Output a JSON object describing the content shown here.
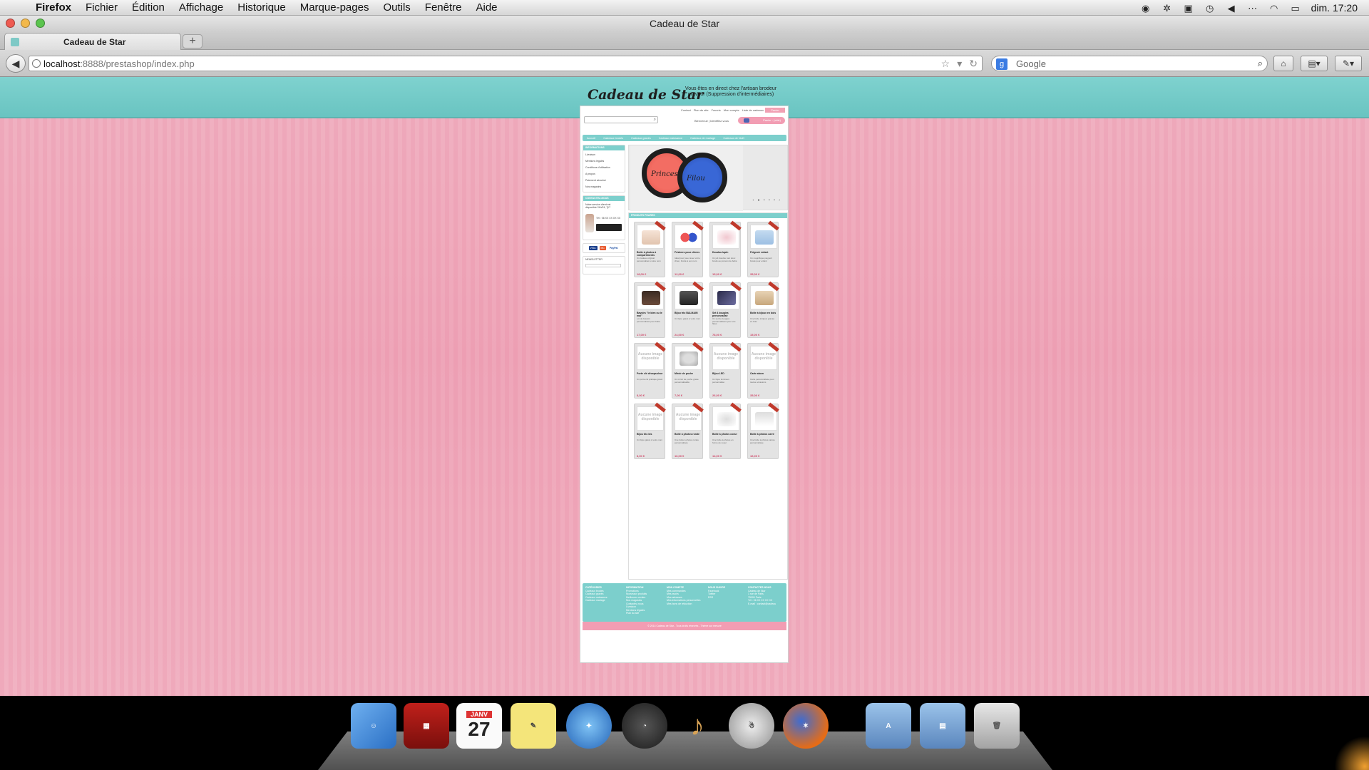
{
  "os_menubar": {
    "app_name": "Firefox",
    "menus": [
      "Fichier",
      "Édition",
      "Affichage",
      "Historique",
      "Marque-pages",
      "Outils",
      "Fenêtre",
      "Aide"
    ],
    "clock": "dim. 17:20"
  },
  "window": {
    "title": "Cadeau de Star"
  },
  "tabs": [
    {
      "label": "Cadeau de Star"
    }
  ],
  "navbar": {
    "url_host": "localhost",
    "url_rest": ":8888/prestashop/index.php",
    "search_placeholder": "Google"
  },
  "shop": {
    "logo": "Cadeau de Star",
    "tagline": "Vous êtes en direct chez l'artisan brodeur graveur (Suppression d'intermédiaires)",
    "top_links": [
      "Contact",
      "Plan du site",
      "Favoris",
      "Mon compte",
      "Liste de cadeaux"
    ],
    "panier_label": "Panier",
    "user_info": "Bienvenue | Identifiez-vous",
    "cart_label": "Panier : (vide)",
    "categories": [
      "Accueil",
      "Cadeaux brodés",
      "Cadeaux gravés",
      "Cadeaux naissance",
      "Cadeaux de mariage",
      "Cadeaux de Noël"
    ],
    "sidebar": {
      "info_title": "INFORMATIONS",
      "info_links": [
        "Livraison",
        "Mentions légales",
        "Conditions d'utilisation",
        "A propos",
        "Paiement sécurisé",
        "Nos magasins"
      ],
      "contact_title": "CONTACTEZ-NOUS",
      "contact_text": "Notre service client est disponible 24h/24, 7j/7",
      "contact_tel": "Tél : 06 XX XX XX XX",
      "payment": [
        "VISA",
        "MC",
        "PayPal"
      ],
      "newsletter_title": "NEWSLETTER"
    },
    "slider": {
      "text_left": "Princesse",
      "text_right": "Filou"
    },
    "featured_title": "PRODUITS PHARES",
    "products": [
      {
        "name": "Boîte à photos à compartiments",
        "desc": "Un cadeau original personnalisé à votre nom",
        "price": "18,00 €",
        "img": "box"
      },
      {
        "name": "Frisbees pour chiens",
        "desc": "Idéal pour jouer avec votre chien, brodé à son nom",
        "price": "12,00 €",
        "img": "frisbee"
      },
      {
        "name": "Doudou lapin",
        "desc": "Un joli doudou tout doux brodé au prénom de bébé",
        "price": "15,00 €",
        "img": "lapin"
      },
      {
        "name": "Peignoir enfant",
        "desc": "Un magnifique peignoir brodé pour enfant",
        "price": "35,00 €",
        "img": "peignoir"
      },
      {
        "name": "Bavoirs \"le bien ou le mal\"",
        "desc": "Lot de bavoirs personnalisés pour bébé",
        "price": "17,00 €",
        "img": "bavoir"
      },
      {
        "name": "Bijou trio BALMAIN",
        "desc": "Un bijou gravé à votre nom",
        "price": "24,00 €",
        "img": "trio"
      },
      {
        "name": "Set 4 bougies personnalisé",
        "desc": "Un set de bougies personnalisées pour vos fêtes",
        "price": "78,00 €",
        "img": "bougies"
      },
      {
        "name": "Boîte à bijoux en bois",
        "desc": "Une boîte à bijoux gravée en bois",
        "price": "15,00 €",
        "img": "boite"
      },
      {
        "name": "Porte clé décapsuleur",
        "desc": "Un porte clé pratique gravé",
        "price": "8,00 €",
        "img": "none"
      },
      {
        "name": "Miroir de poche",
        "desc": "Un miroir de poche gravé personnalisable",
        "price": "7,00 €",
        "img": "miroir"
      },
      {
        "name": "Bijou LED",
        "desc": "Un bijou lumineux personnalisé",
        "price": "26,00 €",
        "img": "none"
      },
      {
        "name": "Carte abcm",
        "desc": "Carte personnalisée pour toutes occasions",
        "price": "35,00 €",
        "img": "none"
      },
      {
        "name": "Bijou trio bis",
        "desc": "Un bijou gravé à votre nom",
        "price": "8,00 €",
        "img": "none"
      },
      {
        "name": "Boîte à photos ronde",
        "desc": "Une boîte à photos ronde personnalisée",
        "price": "16,00 €",
        "img": "none"
      },
      {
        "name": "Boîte à photos coeur",
        "desc": "Une boîte à photos en forme de coeur",
        "price": "14,00 €",
        "img": "coeur"
      },
      {
        "name": "Boîte à photos carré",
        "desc": "Une boîte à photos carrée personnalisée",
        "price": "16,00 €",
        "img": "carre"
      }
    ],
    "no_image_text": "Aucune image disponible",
    "footer": {
      "cols": [
        {
          "title": "CATÉGORIES",
          "lines": [
            "Cadeaux brodés",
            "Cadeaux gravés",
            "Cadeaux naissance",
            "Cadeaux mariage"
          ]
        },
        {
          "title": "INFORMATION",
          "lines": [
            "Promotions",
            "Nouveaux produits",
            "Meilleures ventes",
            "Nos magasins",
            "Contactez-nous",
            "Livraison",
            "Mentions légales",
            "Plan du site"
          ]
        },
        {
          "title": "MON COMPTE",
          "lines": [
            "Mes commandes",
            "Mes avoirs",
            "Mes adresses",
            "Mes informations personnelles",
            "Mes bons de réduction"
          ]
        },
        {
          "title": "NOUS SUIVRE",
          "lines": [
            "Facebook",
            "Twitter",
            "RSS"
          ]
        },
        {
          "title": "CONTACTEZ-NOUS",
          "lines": [
            "Cadeau de Star",
            "1 rue de Paris",
            "75000 Paris",
            "Tél : 06 XX XX XX XX",
            "E-mail : contact@cadeau"
          ]
        }
      ],
      "copyright": "© 2014 Cadeau de Star - Tous droits réservés - Thème sur mesure"
    }
  },
  "dock": [
    "Finder",
    "Photo Booth",
    "Calendrier",
    "Stickies",
    "Safari",
    "Instruments",
    "GarageBand",
    "Automator",
    "Firefox",
    "Applications",
    "Documents",
    "Corbeille"
  ],
  "calendar_icon": {
    "month": "JANV",
    "day": "27"
  }
}
